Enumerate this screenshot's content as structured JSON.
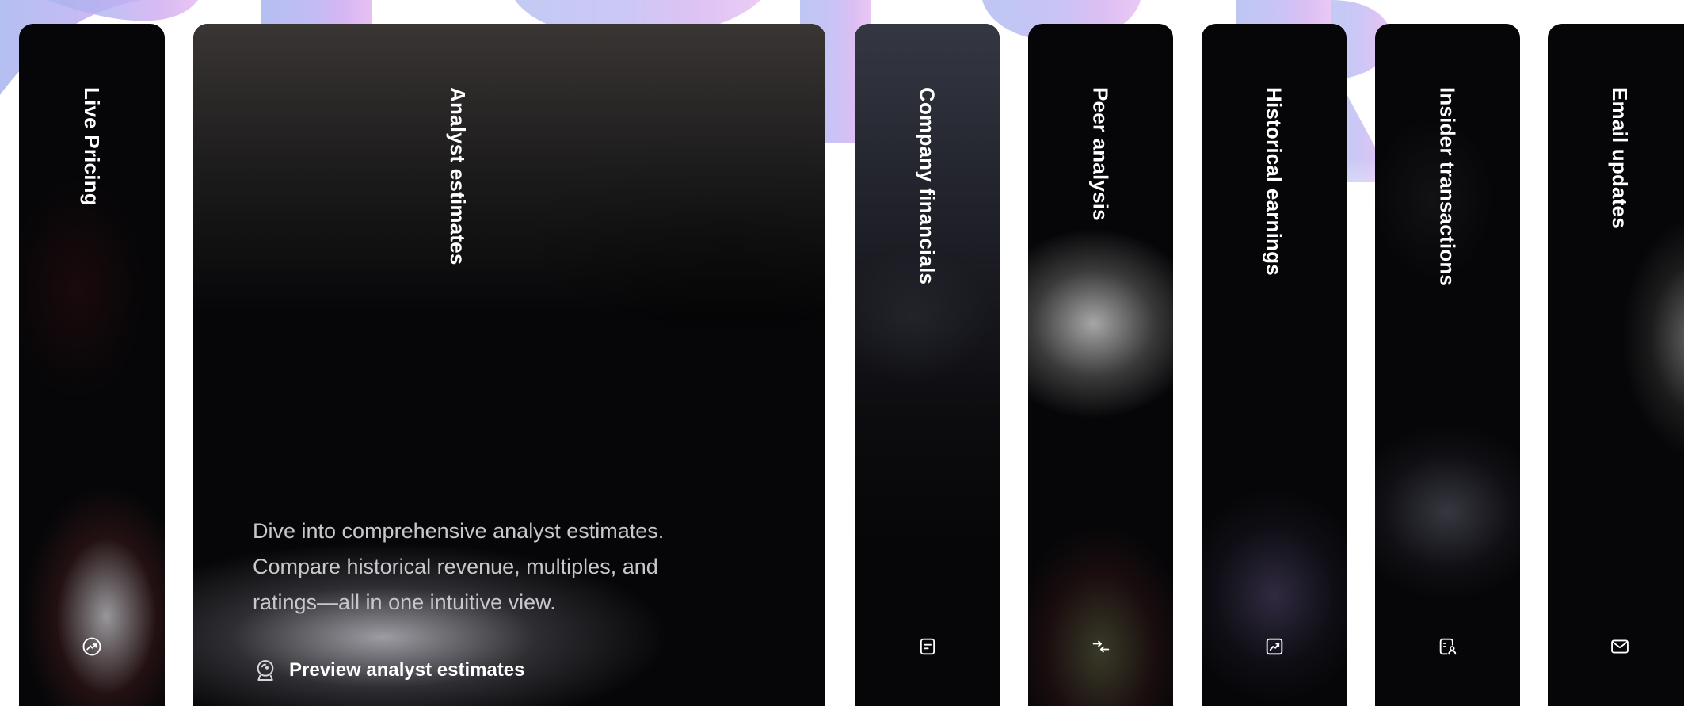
{
  "cards": [
    {
      "title": "Live Pricing",
      "icon": "trending-up-circle-icon"
    },
    {
      "title": "Analyst estimates",
      "icon": "crystal-ball-icon",
      "description": "Dive into comprehensive analyst estimates. Compare historical revenue, multiples, and ratings—all in one intuitive view.",
      "cta_label": "Preview analyst estimates"
    },
    {
      "title": "Company financials",
      "icon": "document-lines-icon"
    },
    {
      "title": "Peer analysis",
      "icon": "arrows-compare-icon"
    },
    {
      "title": "Historical earnings",
      "icon": "chart-line-square-icon"
    },
    {
      "title": "Insider transactions",
      "icon": "person-badge-icon"
    },
    {
      "title": "Email updates",
      "icon": "mail-icon"
    }
  ],
  "colors": {
    "card_bg": "#060608",
    "text": "#ffffff",
    "description_text": "#c9c7cc",
    "background_accent": "#b9a8f0"
  }
}
